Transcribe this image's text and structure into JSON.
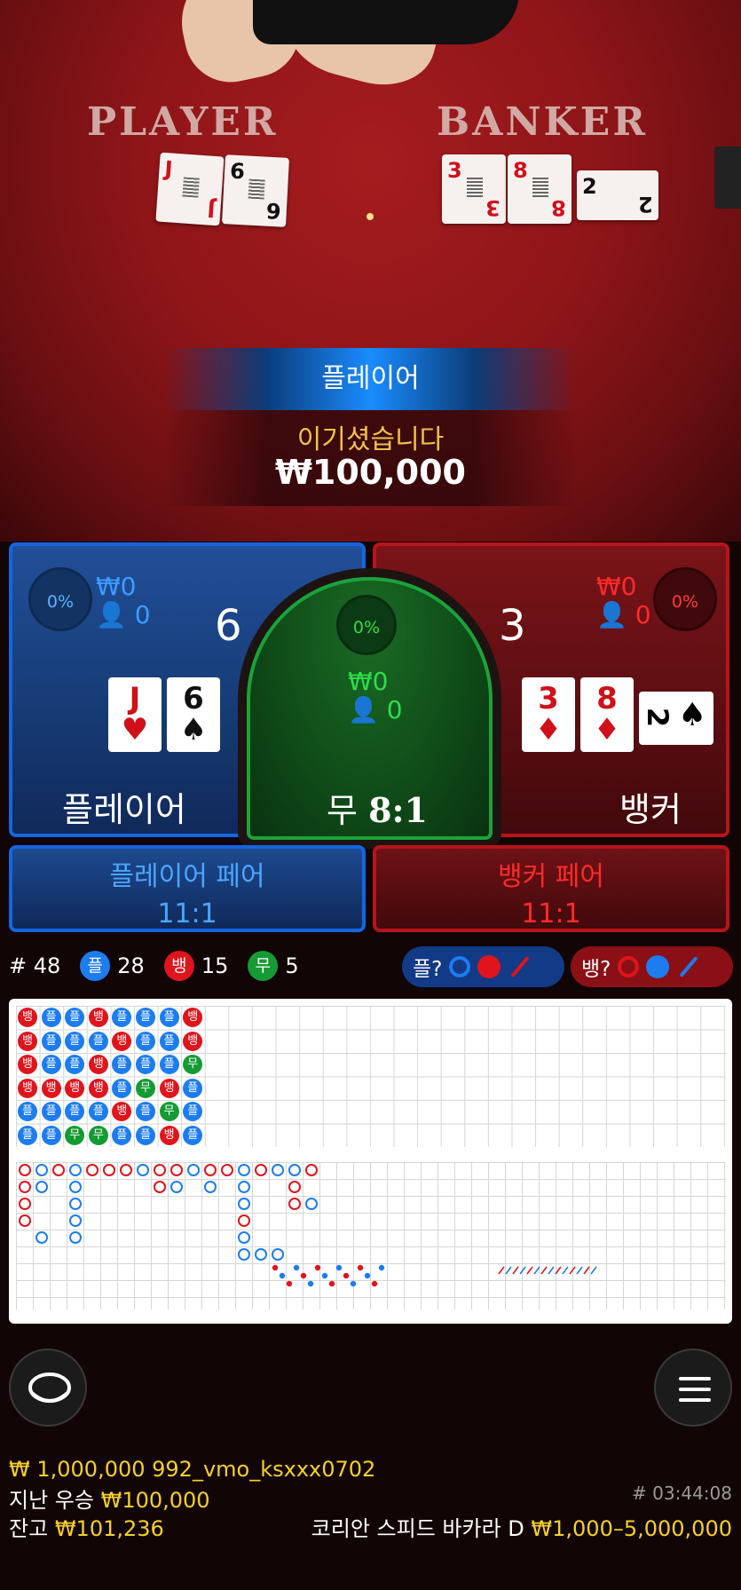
{
  "video": {
    "player_label": "PLAYER",
    "banker_label": "BANKER",
    "player_cards": [
      {
        "rank": "J",
        "suit": "♥",
        "color": "red"
      },
      {
        "rank": "6",
        "suit": "♠",
        "color": "black"
      }
    ],
    "banker_cards": [
      {
        "rank": "3",
        "suit": "♦",
        "color": "red"
      },
      {
        "rank": "8",
        "suit": "♦",
        "color": "red"
      },
      {
        "rank": "2",
        "suit": "♠",
        "color": "black"
      }
    ]
  },
  "result": {
    "winner": "플레이어",
    "message": "이기셨습니다",
    "amount": "₩100,000"
  },
  "bets": {
    "player": {
      "pct": "0%",
      "amount": "₩0",
      "users": "0",
      "score": "6",
      "label": "플레이어",
      "cards": [
        {
          "rank": "J",
          "suit": "♥",
          "color": "red"
        },
        {
          "rank": "6",
          "suit": "♠",
          "color": "black"
        }
      ]
    },
    "tie": {
      "pct": "0%",
      "amount": "₩0",
      "users": "0",
      "label": "무",
      "payout": "8:1"
    },
    "banker": {
      "pct": "0%",
      "amount": "₩0",
      "users": "0",
      "score": "3",
      "label": "뱅커",
      "cards": [
        {
          "rank": "3",
          "suit": "♦",
          "color": "red"
        },
        {
          "rank": "8",
          "suit": "♦",
          "color": "red"
        },
        {
          "rank": "2",
          "suit": "♠",
          "color": "black"
        }
      ]
    },
    "player_pair": {
      "label": "플레이어 페어",
      "payout": "11:1"
    },
    "banker_pair": {
      "label": "뱅커 페어",
      "payout": "11:1"
    }
  },
  "stats": {
    "round_label": "# 48",
    "player_badge": "플",
    "player_count": "28",
    "banker_badge": "뱅",
    "banker_count": "15",
    "tie_badge": "무",
    "tie_count": "5",
    "predict_player": "플?",
    "predict_banker": "뱅?"
  },
  "colors": {
    "player": "#1c7cf0",
    "banker": "#e0141c",
    "tie": "#169a34",
    "gold": "#f5d02a"
  },
  "bead_road": [
    [
      "뱅",
      "플",
      "플",
      "뱅",
      "플",
      "플",
      "플",
      "뱅"
    ],
    [
      "뱅",
      "플",
      "플",
      "플",
      "뱅",
      "플",
      "플",
      "뱅"
    ],
    [
      "뱅",
      "플",
      "플",
      "뱅",
      "플",
      "플",
      "플",
      "무"
    ],
    [
      "뱅",
      "뱅",
      "뱅",
      "뱅",
      "플",
      "무",
      "뱅",
      "플"
    ],
    [
      "플",
      "플",
      "플",
      "플",
      "뱅",
      "플",
      "무",
      "플"
    ],
    [
      "플",
      "플",
      "무",
      "무",
      "플",
      "플",
      "뱅",
      "플"
    ]
  ],
  "footer": {
    "ticker": "₩ 1,000,000 992_vmo_ksxxx0702",
    "last_win_label": "지난 우승",
    "last_win_amount": "₩100,000",
    "round_time": "# 03:44:08",
    "balance_label": "잔고",
    "balance_amount": "₩101,236",
    "table_name": "코리안 스피드 바카라 D",
    "limits": "₩1,000–5,000,000"
  },
  "icons": {
    "chat": "chat-icon",
    "menu": "menu-icon"
  }
}
